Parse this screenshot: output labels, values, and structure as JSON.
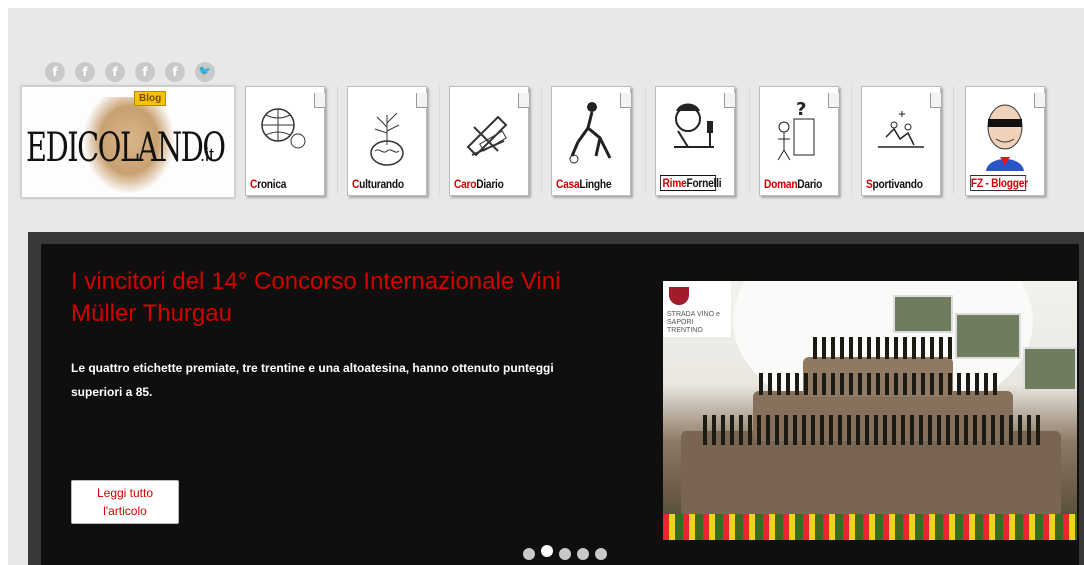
{
  "header": {
    "social_icons": [
      {
        "icon": "facebook-icon",
        "glyph": "f"
      },
      {
        "icon": "facebook-icon",
        "glyph": "f"
      },
      {
        "icon": "facebook-icon",
        "glyph": "f"
      },
      {
        "icon": "facebook-icon",
        "glyph": "f"
      },
      {
        "icon": "facebook-icon",
        "glyph": "f"
      },
      {
        "icon": "twitter-icon",
        "glyph": "🐦"
      }
    ],
    "logo": {
      "text": "EDICOLANDO",
      "suffix": ".it",
      "badge": "Blog"
    }
  },
  "sections": [
    {
      "name": "cronica",
      "label_red": "C",
      "label_rest": "ronica"
    },
    {
      "name": "culturando",
      "label_red": "C",
      "label_rest": "ulturando"
    },
    {
      "name": "carodiario",
      "label_red": "Caro",
      "label_rest": "Diario"
    },
    {
      "name": "casalinghe",
      "label_red": "Casa",
      "label_rest": "Linghe"
    },
    {
      "name": "rimefornelli",
      "label_red": "Rime",
      "label_rest": "Fornelli"
    },
    {
      "name": "domandario",
      "label_red": "Doman",
      "label_rest": "Dario"
    },
    {
      "name": "sportivando",
      "label_red": "S",
      "label_rest": "portivando"
    },
    {
      "name": "fz-blogger",
      "label_red": "FZ",
      "label_rest": " - Blogger"
    }
  ],
  "slider": {
    "title": "I vincitori del 14° Concorso Internazionale Vini Müller Thurgau",
    "description": "Le quattro etichette premiate, tre trentine e una altoatesina, hanno ottenuto punteggi superiori a 85.",
    "read_more": "Leggi tutto l'articolo",
    "image_badge": "STRADA VINO e SAPORI TRENTINO",
    "dots_count": 5,
    "active_dot": 2
  },
  "colors": {
    "accent": "#d40000",
    "slide_bg": "#0f0f0f",
    "frame": "#383838",
    "page_bg": "#e8e8e8"
  }
}
